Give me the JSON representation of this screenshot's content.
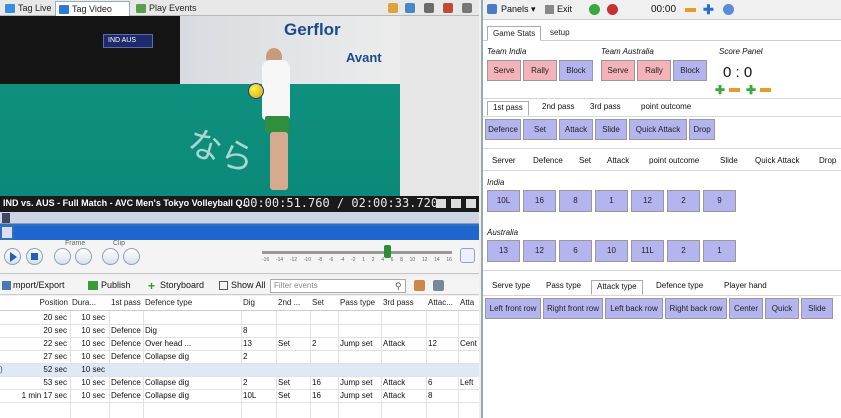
{
  "top_tabs": [
    {
      "label": "Tag Live"
    },
    {
      "label": "Tag Video Clip"
    },
    {
      "label": "Play Events"
    }
  ],
  "video": {
    "ad_text_1": "Gerflor",
    "ad_text_2": "Avant",
    "court_text": "なら",
    "caption_title": "IND vs. AUS - Full Match - AVC Men's Tokyo Volleyball Q...",
    "caption_time": "00:00:51.760 / 02:00:33.720",
    "score_overlay": "IND AUS"
  },
  "controls": {
    "frame_label": "Frame",
    "clip_label": "Clip",
    "slider_ticks": [
      "-16",
      "-14",
      "-12",
      "-10",
      "-8",
      "-6",
      "-4",
      "-2",
      "1",
      "2",
      "4",
      "6",
      "8",
      "10",
      "12",
      "14",
      "16"
    ]
  },
  "toolbar2": {
    "import_export": "mport/Export",
    "publish": "Publish",
    "storyboard": "Storyboard",
    "show_all": "Show All",
    "filter_placeholder": "Filter events"
  },
  "grid": {
    "columns": [
      "Position",
      "Dura...",
      "1st pass",
      "Defence type",
      "Dig",
      "2nd ...",
      "Set",
      "Pass type",
      "3rd pass",
      "Attac...",
      "Atta"
    ],
    "rows": [
      [
        "20 sec",
        "10 sec",
        "",
        "",
        "",
        "",
        "",
        "",
        "",
        "",
        ""
      ],
      [
        "20 sec",
        "10 sec",
        "Defence",
        "Dig",
        "8",
        "",
        "",
        "",
        "",
        "",
        ""
      ],
      [
        "22 sec",
        "10 sec",
        "Defence",
        "Over head ...",
        "13",
        "Set",
        "2",
        "Jump set",
        "Attack",
        "12",
        "Cent"
      ],
      [
        "27 sec",
        "10 sec",
        "Defence",
        "Collapse dig",
        "2",
        "",
        "",
        "",
        "",
        "",
        ""
      ],
      [
        "52 sec",
        "10 sec",
        "",
        "",
        "",
        "",
        "",
        "",
        "",
        "",
        ""
      ],
      [
        "53 sec",
        "10 sec",
        "Defence",
        "Collapse dig",
        "2",
        "Set",
        "16",
        "Jump set",
        "Attack",
        "6",
        "Left"
      ],
      [
        "1 min 17 sec",
        "10 sec",
        "Defence",
        "Collapse dig",
        "10L",
        "Set",
        "16",
        "Jump set",
        "Attack",
        "8",
        ""
      ]
    ]
  },
  "right": {
    "toolbar": {
      "panels": "Panels",
      "exit": "Exit",
      "timer": "00:00"
    },
    "tabs": [
      "Game Stats",
      "setup"
    ],
    "team_india": "Team India",
    "team_australia": "Team Australia",
    "score_panel": "Score Panel",
    "score": "0 : 0",
    "action_buttons": [
      "Serve",
      "Rally",
      "Block"
    ],
    "pass_tabs": [
      "1st pass",
      "2nd pass",
      "3rd pass",
      "point outcome"
    ],
    "pass_buttons": [
      "Defence",
      "Set",
      "Attack",
      "Slide",
      "Quick Attack",
      "Drop"
    ],
    "stat_headers": [
      "Server",
      "Defence",
      "Set",
      "Attack",
      "point outcome",
      "Slide",
      "Quick Attack",
      "Drop"
    ],
    "india_label": "India",
    "india_players": [
      "10L",
      "16",
      "8",
      "1",
      "12",
      "2",
      "9"
    ],
    "australia_label": "Australia",
    "australia_players": [
      "13",
      "12",
      "6",
      "10",
      "11L",
      "2",
      "1"
    ],
    "type_tabs": [
      "Serve type",
      "Pass type",
      "Attack type",
      "Defence type",
      "Player hand"
    ],
    "attack_buttons": [
      "Left front row",
      "Right front row",
      "Left back row",
      "Right back row",
      "Center",
      "Quick",
      "Slide"
    ]
  },
  "colors": {
    "pink": "#f3b3b8",
    "lavender": "#b4b4ef",
    "timeline": "#1e66cf",
    "plus_green": "#3aa83a",
    "minus_orange": "#e89a2c"
  }
}
